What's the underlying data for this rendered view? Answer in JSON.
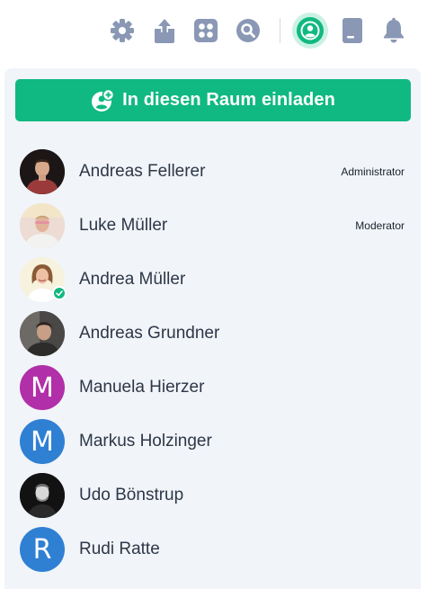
{
  "toolbar": {
    "icons": [
      "settings-icon",
      "share-icon",
      "apps-icon",
      "search-icon",
      "members-icon",
      "document-icon",
      "bell-icon"
    ],
    "icon_color": "#8a98b5",
    "active_color": "#10b981"
  },
  "invite": {
    "label": "In diesen Raum einladen",
    "icon": "add-user-icon",
    "color": "#10b981"
  },
  "members": [
    {
      "name": "Andreas Fellerer",
      "role": "Administrator",
      "avatar": "photo"
    },
    {
      "name": "Luke Müller",
      "role": "Moderator",
      "avatar": "photo"
    },
    {
      "name": "Andrea Müller",
      "role": "",
      "avatar": "photo",
      "verified": true
    },
    {
      "name": "Andreas Grundner",
      "role": "",
      "avatar": "photo"
    },
    {
      "name": "Manuela Hierzer",
      "role": "",
      "avatar": "initial",
      "initial": "M",
      "color": "#b12fa8"
    },
    {
      "name": "Markus Holzinger",
      "role": "",
      "avatar": "initial",
      "initial": "M",
      "color": "#2f80d3"
    },
    {
      "name": "Udo Bönstrup",
      "role": "",
      "avatar": "photo"
    },
    {
      "name": "Rudi Ratte",
      "role": "",
      "avatar": "initial",
      "initial": "R",
      "color": "#2f80d3"
    }
  ]
}
